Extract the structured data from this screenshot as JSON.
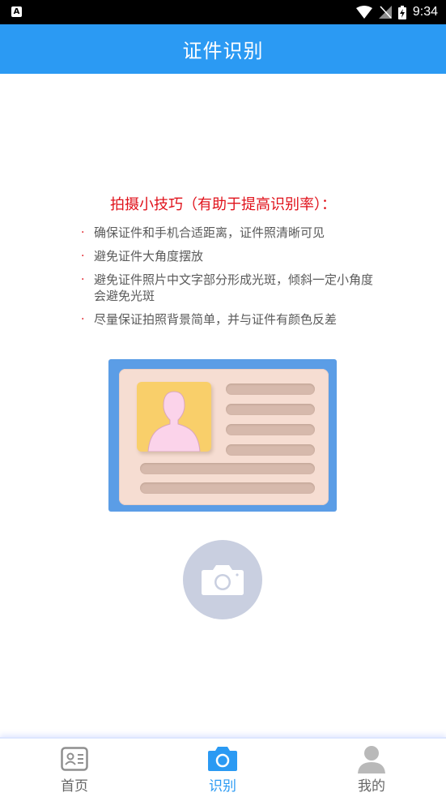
{
  "status_bar": {
    "app_icon_letter": "A",
    "time": "9:34"
  },
  "header": {
    "title": "证件识别"
  },
  "tips": {
    "title": "拍摄小技巧（有助于提高识别率）：",
    "bullet": "·",
    "items": [
      "确保证件和手机合适距离，证件照清晰可见",
      "避免证件大角度摆放",
      "避免证件照片中文字部分形成光斑，倾斜一定小角度会避免光斑",
      "尽量保证拍照背景简单，并与证件有颜色反差"
    ]
  },
  "illustration": {
    "icon": "id-card-icon"
  },
  "camera": {
    "icon": "camera-icon"
  },
  "bottom_nav": {
    "items": [
      {
        "label": "首页",
        "icon": "id-card-icon",
        "active": false
      },
      {
        "label": "识别",
        "icon": "camera-icon",
        "active": true
      },
      {
        "label": "我的",
        "icon": "user-icon",
        "active": false
      }
    ]
  },
  "colors": {
    "primary": "#2b9af3",
    "tip_title": "#e0121b",
    "tip_text": "#5a5a5a",
    "card_frame": "#5b9de6",
    "card_body": "#f6ddd2",
    "photo_bg": "#f9cf6a",
    "camera_circle": "#c9cfe0",
    "nav_inactive": "#9a9a9a"
  }
}
